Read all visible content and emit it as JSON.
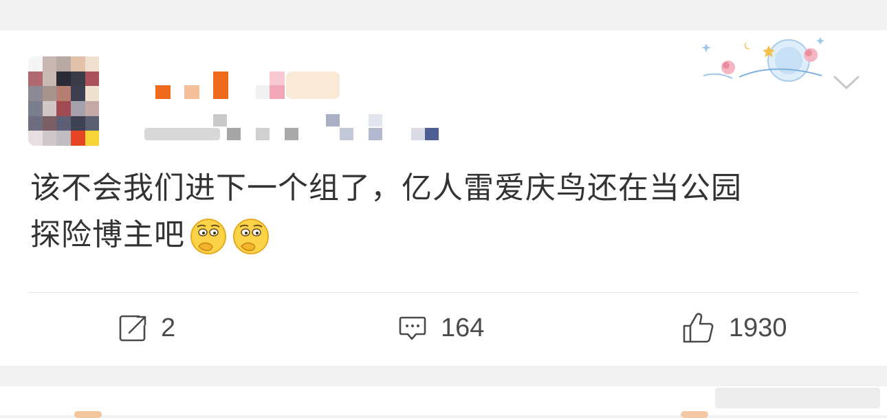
{
  "post": {
    "text_line1": "该不会我们进下一个组了，亿人雷爱庆鸟还在当公园",
    "text_line2": "探险博主吧",
    "emojis": [
      "thinking-face-icon",
      "thinking-face-icon"
    ]
  },
  "actions": {
    "repost": {
      "icon": "repost-icon",
      "count": "2"
    },
    "comment": {
      "icon": "comment-icon",
      "count": "164"
    },
    "like": {
      "icon": "thumbs-up-icon",
      "count": "1930"
    }
  },
  "colors": {
    "background": "#f2f2f2",
    "card": "#ffffff",
    "text": "#333333",
    "icon": "#4a4a4a",
    "divider": "#e6e6e6"
  }
}
